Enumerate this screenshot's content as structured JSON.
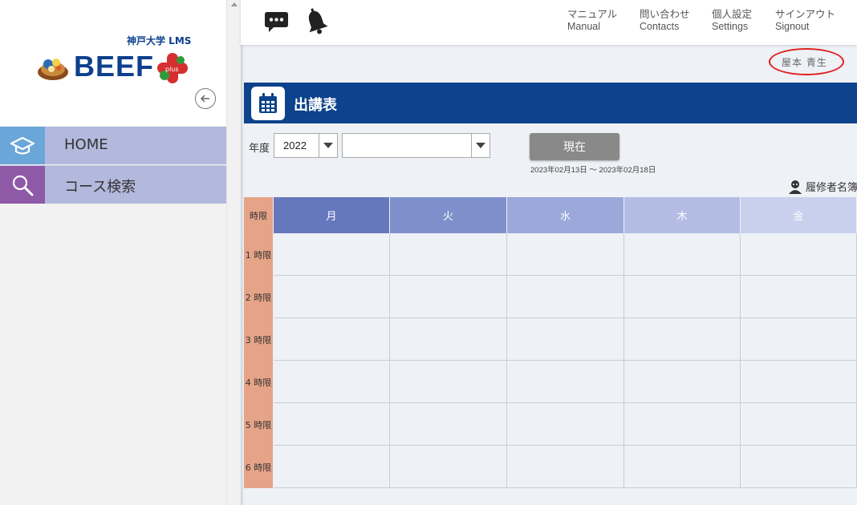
{
  "sidebar": {
    "logo_subtitle": "神戸大学 LMS",
    "logo_text": "BEEF",
    "logo_plus_text": "plus",
    "items": [
      {
        "label": "HOME",
        "icon": "graduation-cap-icon"
      },
      {
        "label": "コース検索",
        "icon": "magnifier-icon"
      }
    ]
  },
  "header": {
    "links": [
      {
        "jp": "マニュアル",
        "en": "Manual"
      },
      {
        "jp": "問い合わせ",
        "en": "Contacts"
      },
      {
        "jp": "個人設定",
        "en": "Settings"
      },
      {
        "jp": "サインアウト",
        "en": "Signout"
      }
    ]
  },
  "user": {
    "name": "屋本 青生"
  },
  "page": {
    "title": "出講表"
  },
  "controls": {
    "year_label": "年度",
    "year_value": "2022",
    "term_value": "",
    "now_button": "現在",
    "date_range": "2023年02月13日 ～ 2023年02月18日",
    "roster_link": "履修者名簿"
  },
  "timetable": {
    "period_header": "時限",
    "days": [
      "月",
      "火",
      "水",
      "木",
      "金"
    ],
    "day_colors": [
      "#6578bd",
      "#7e8fcb",
      "#9ba8d9",
      "#b3bde4",
      "#c8d0ed"
    ],
    "periods": [
      "1 時限",
      "2 時限",
      "3 時限",
      "4 時限",
      "5 時限",
      "6 時限"
    ]
  },
  "colors": {
    "title_bar": "#0d428c",
    "sidebar_item_bg": "#b3b9dd",
    "period_bg": "#e5a387",
    "annotation": "#e02020"
  }
}
